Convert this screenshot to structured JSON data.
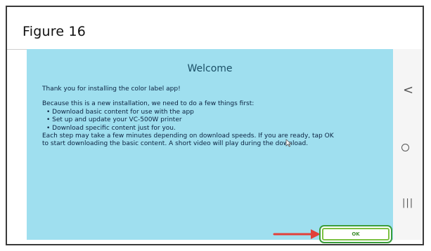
{
  "figure": {
    "title": "Figure 16"
  },
  "dialog": {
    "title": "Welcome",
    "intro": "Thank you for installing the color label app!",
    "lead": "Because this is a new installation, we need to do a few things first:",
    "bullets": [
      "• Download basic content for use with the app",
      "• Set up and update your VC-500W printer",
      "• Download specific content just for you."
    ],
    "note_line1": " Each step may take a few minutes depending on download speeds. If you are ready, tap OK",
    "note_line2": "to start downloading the basic content. A short video will play during the download.",
    "ok_label": "OK"
  },
  "navbar": {
    "back_glyph": "<",
    "home_icon": "circle-home-icon",
    "recent_glyph": "|||"
  },
  "colors": {
    "screen_bg": "#9fdfef",
    "title_color": "#1a4f66",
    "ok_border": "#7cc142",
    "arrow": "#e2403a"
  }
}
